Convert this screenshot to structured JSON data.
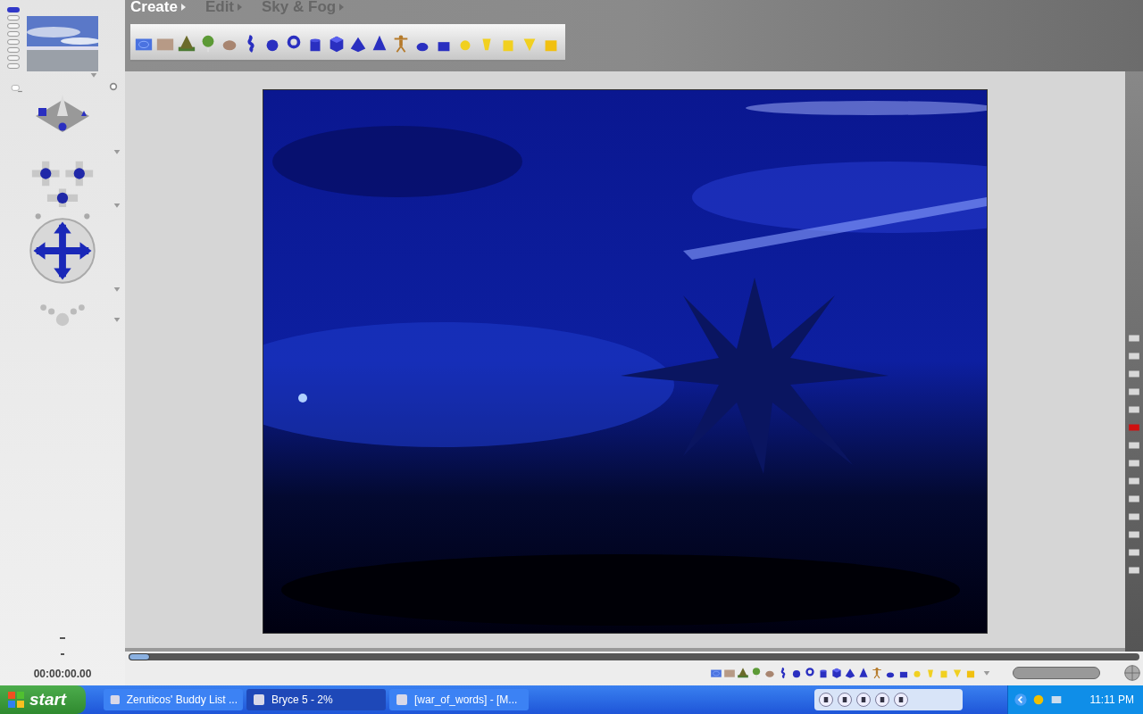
{
  "menu_tabs": [
    {
      "label": "Create",
      "selected": true
    },
    {
      "label": "Edit",
      "selected": false
    },
    {
      "label": "Sky & Fog",
      "selected": false
    }
  ],
  "time_display": "00:00:00.00",
  "taskbar": {
    "start_label": "start",
    "tasks": [
      {
        "label": "Zeruticos' Buddy List ...",
        "selected": false
      },
      {
        "label": "Bryce 5 - 2%",
        "selected": true
      },
      {
        "label": "[war_of_words] - [M...",
        "selected": false
      }
    ],
    "clock": "11:11 PM"
  }
}
